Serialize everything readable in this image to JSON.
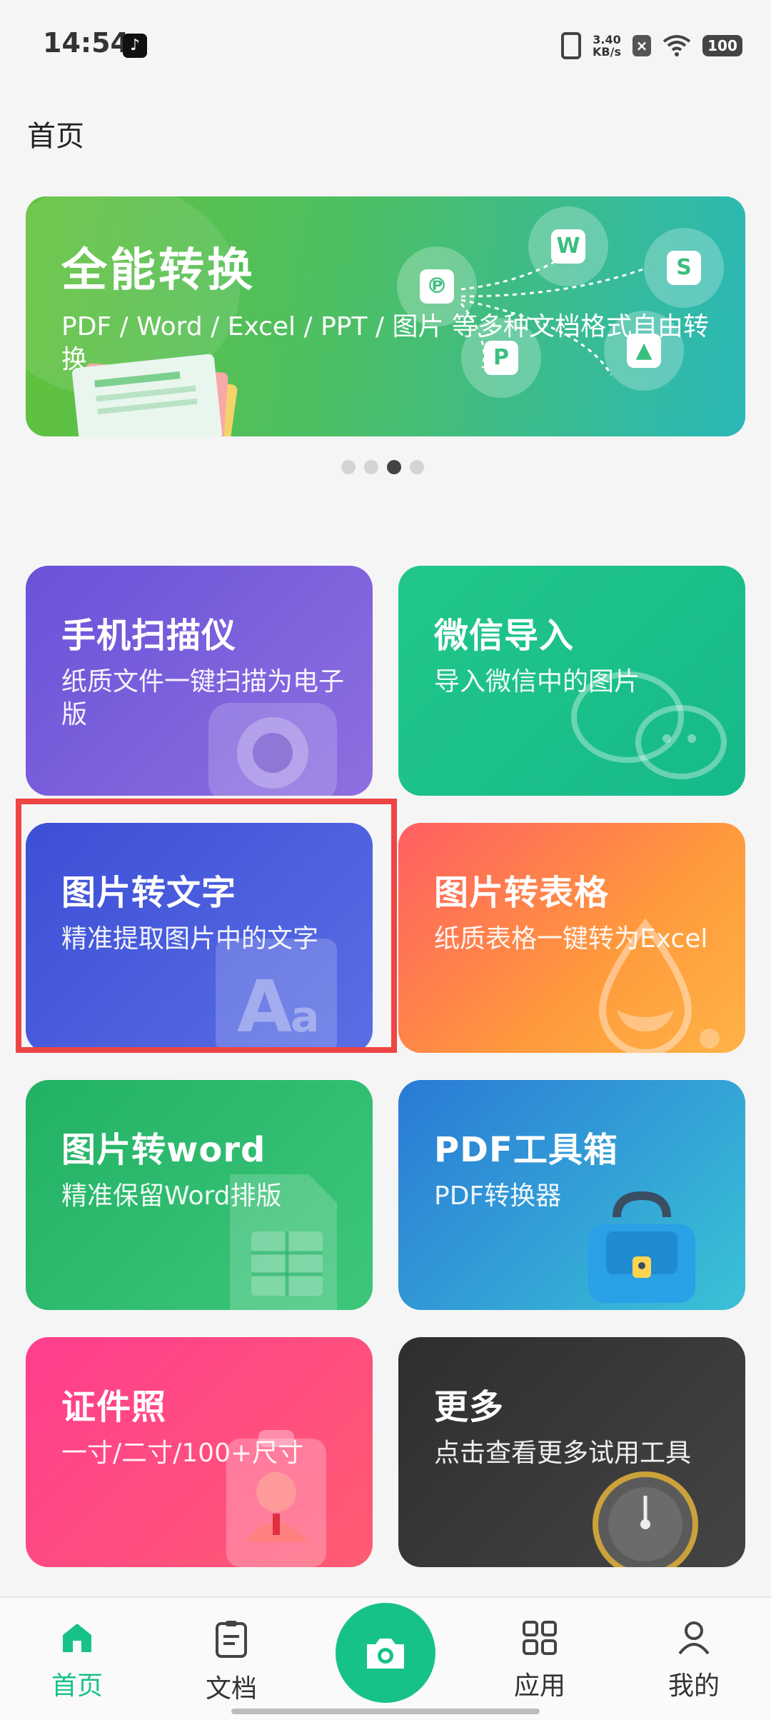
{
  "status_bar": {
    "time": "14:54",
    "net_speed_value": "3.40",
    "net_speed_unit": "KB/s",
    "battery": "100"
  },
  "page_title": "首页",
  "banner": {
    "title": "全能转换",
    "subtitle": "PDF / Word / Excel / PPT / 图片 等多种文档格式自由转换",
    "icons": [
      "pdf-icon",
      "word-icon",
      "slides-icon",
      "ppt-icon",
      "image-icon"
    ]
  },
  "carousel": {
    "count": 4,
    "active_index": 2
  },
  "cards": [
    {
      "title": "手机扫描仪",
      "subtitle": "纸质文件一键扫描为电子版"
    },
    {
      "title": "微信导入",
      "subtitle": "导入微信中的图片"
    },
    {
      "title": "图片转文字",
      "subtitle": "精准提取图片中的文字"
    },
    {
      "title": "图片转表格",
      "subtitle": "纸质表格一键转为Excel"
    },
    {
      "title": "图片转word",
      "subtitle": "精准保留Word排版"
    },
    {
      "title": "PDF工具箱",
      "subtitle": "PDF转换器"
    },
    {
      "title": "证件照",
      "subtitle": "一寸/二寸/100+尺寸"
    },
    {
      "title": "更多",
      "subtitle": "点击查看更多试用工具"
    }
  ],
  "bottom_nav": {
    "items": [
      {
        "label": "首页",
        "icon": "home-icon"
      },
      {
        "label": "文档",
        "icon": "document-icon"
      },
      {
        "label": "应用",
        "icon": "apps-icon"
      },
      {
        "label": "我的",
        "icon": "profile-icon"
      }
    ],
    "camera_icon": "camera-icon",
    "active_color": "#17c28a"
  }
}
